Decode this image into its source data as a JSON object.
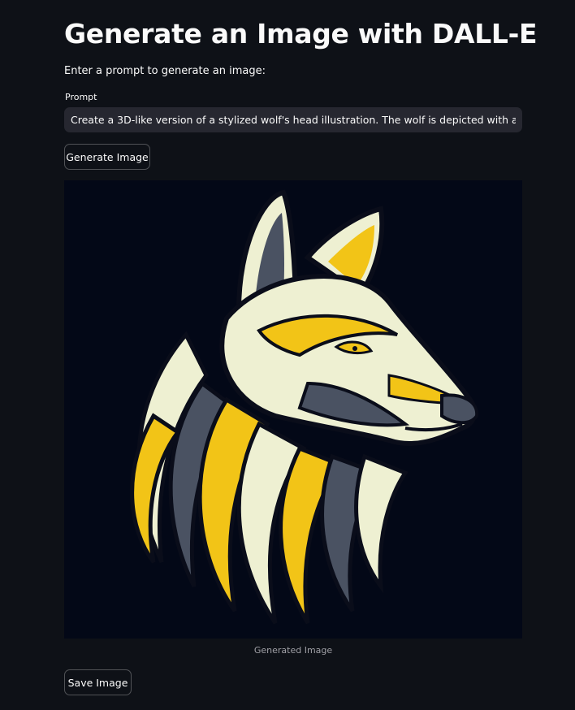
{
  "page": {
    "title": "Generate an Image with DALL-E",
    "subtitle": "Enter a prompt to generate an image:"
  },
  "prompt": {
    "label": "Prompt",
    "value": "Create a 3D-like version of a stylized wolf's head illustration. The wolf is depicted with a bold yellow and"
  },
  "buttons": {
    "generate_label": "Generate Image",
    "save_label": "Save Image"
  },
  "image": {
    "caption": "Generated Image",
    "subject": "wolf-head-illustration",
    "colors": {
      "background": "#030817",
      "yellow": "#f2c417",
      "cream": "#eef0d2",
      "slate": "#4a5262",
      "outline": "#0a0d1a"
    }
  }
}
